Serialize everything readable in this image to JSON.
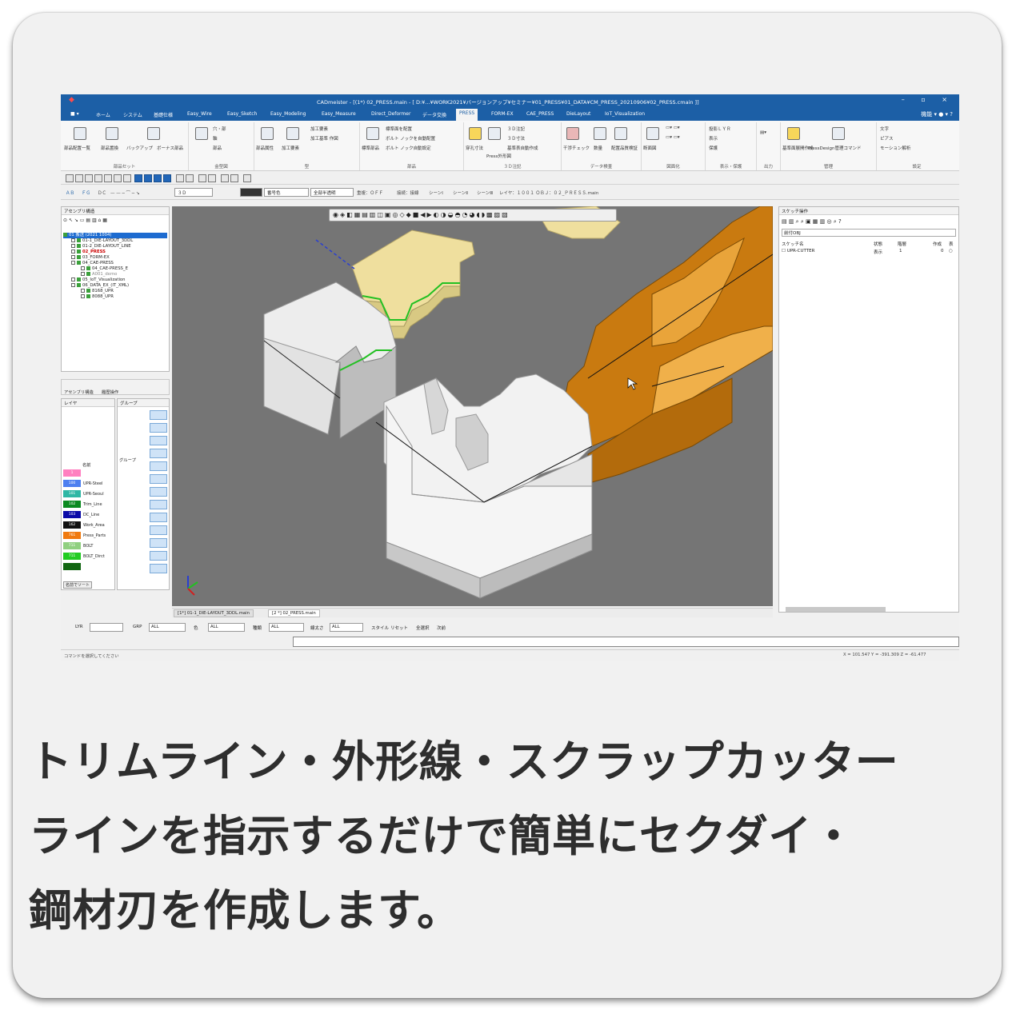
{
  "app": {
    "title": "CADmeister - [(1*) 02_PRESS.main - [ D:¥...¥WORK2021¥バージョンアップ¥セミナー¥01_PRESS¥01_DATA¥CM_PRESS_20210906¥02_PRESS.cmain ]]",
    "window_controls": "– ▫ ×"
  },
  "ribbon_tabs": [
    "ホーム",
    "システム",
    "基礎仕様",
    "Easy_Wire",
    "Easy_Sketch",
    "Easy_Modeling",
    "Easy_Measure",
    "Direct_Deformer",
    "データ交換",
    "PRESS",
    "FORM-EX",
    "CAE_PRESS",
    "DieLayout",
    "IoT_Visualization"
  ],
  "active_tab": "PRESS",
  "tabs_right": "機能 ▾ ● ▾ ?",
  "ribbon_groups": [
    {
      "label": "部品セット",
      "items": [
        "部品配置一覧",
        "部品置換",
        "バックアップ",
        "ボーナス部品"
      ]
    },
    {
      "label": "金型図",
      "items": [
        "穴・部",
        "軸",
        "部品"
      ]
    },
    {
      "label": "型",
      "items": [
        "部品属性",
        "加工要素",
        "加工要素",
        "加工基準 作図"
      ]
    },
    {
      "label": "部品",
      "items": [
        "標準部品",
        "標準面を配置",
        "ボルト ノックを自動配置",
        "ボルト ノック自動設定"
      ]
    },
    {
      "label": "３Ｄ注記",
      "items": [
        "穿孔寸法",
        "Press外形図",
        "３Ｄ注記",
        "３Ｄ寸法",
        "基準表自動作成"
      ]
    },
    {
      "label": "データ検査",
      "items": [
        "干渉チェック",
        "数量",
        "配置品質検証"
      ]
    },
    {
      "label": "図面化",
      "items": [
        "断面図",
        "図面化"
      ]
    },
    {
      "label": "表示・保護",
      "items": [
        "投影ＬＹＲ",
        "表示",
        "保護"
      ]
    },
    {
      "label": "出力",
      "items": [
        "出力"
      ]
    },
    {
      "label": "管理",
      "items": [
        "基準面展開作成",
        "PressDesign管理コマンド"
      ]
    },
    {
      "label": "設定",
      "items": [
        "文字",
        "ピアス",
        "モーション解析"
      ]
    }
  ],
  "options_bar": {
    "mode_buttons": [
      "ＡＢ",
      "ＦＧ",
      "ＤＣ"
    ],
    "view_select": "３Ｄ",
    "layer_select": "番号色",
    "color_select": "全部半透明",
    "status_items": [
      "重複：ＯＦＦ",
      "接続：接線",
      "シーンⅠ",
      "シーンⅡ",
      "シーンⅢ",
      "レイヤ：１００１ ＯＢＪ：０２_ＰＲＥＳＳ.main"
    ]
  },
  "assembly_panel": {
    "title": "アセンブリ構造",
    "tree": [
      {
        "label": "01 搬送 (2021 1004) ",
        "level": 0,
        "selected": true
      },
      {
        "label": "01-1_DIE-LAYOUT_3DDL",
        "level": 1
      },
      {
        "label": "01-2_DIE-LAYOUT_LINE",
        "level": 1
      },
      {
        "label": "02_PRESS",
        "level": 1,
        "highlight": true
      },
      {
        "label": "03_FORM-EX",
        "level": 1
      },
      {
        "label": "04_CAE-PRESS",
        "level": 1
      },
      {
        "label": "04_CAE-PRESS_E",
        "level": 2
      },
      {
        "label": "A001_demo",
        "level": 2
      },
      {
        "label": "05_IoT_Visualization",
        "level": 1
      },
      {
        "label": "06_DATA_EX_(IT_XML)",
        "level": 1
      },
      {
        "label": "8168_UPR",
        "level": 2
      },
      {
        "label": "8088_UPR",
        "level": 2
      }
    ],
    "bottom_tabs": [
      "アセンブリ構造",
      "履歴操作"
    ]
  },
  "layer_panel": {
    "title": "レイヤ",
    "header": "名前",
    "rows": [
      {
        "num": "1",
        "name": "",
        "color": "#ff80c0"
      },
      {
        "num": "100",
        "name": "UPR-Steel",
        "color": "#4d7ff0"
      },
      {
        "num": "101",
        "name": "UPR-Seoul",
        "color": "#2fb7a5"
      },
      {
        "num": "102",
        "name": "Trim_Line",
        "color": "#0b8a20"
      },
      {
        "num": "103",
        "name": "DC_Line",
        "color": "#0a0aa8"
      },
      {
        "num": "162",
        "name": "Work_Area",
        "color": "#111111"
      },
      {
        "num": "761",
        "name": "Press_Parts",
        "color": "#f07a10"
      },
      {
        "num": "711",
        "name": "BOLT",
        "color": "#90d080"
      },
      {
        "num": "711",
        "name": "BOLT_Dirct",
        "color": "#22cc22"
      },
      {
        "num": "",
        "name": "",
        "color": "#126612"
      }
    ],
    "footer": "名前でソート"
  },
  "group_panel": {
    "title": "グループ",
    "rows": [
      "グループ"
    ]
  },
  "right_panel": {
    "title": "スケッチ操作",
    "filter": "前付OBJ",
    "columns": [
      "スケッチ名",
      "状態",
      "階層",
      "作成",
      "表"
    ],
    "rows": [
      {
        "name": "UPR-CUTTER",
        "state": "表示",
        "level": "1",
        "c4": "0",
        "c5": "○"
      }
    ]
  },
  "doc_tabs": [
    {
      "label": "[1*] 01-1_DIE-LAYOUT_3DDL.main",
      "active": false
    },
    {
      "label": "[2 *] 02_PRESS.main",
      "active": true
    }
  ],
  "filter_bar": {
    "labels": [
      "LYR",
      "GRP",
      "色",
      "種類",
      "線太さ"
    ],
    "values": [
      "",
      "ALL",
      "ALL",
      "ALL",
      "ALL"
    ],
    "buttons": [
      "スタイル",
      "リセット",
      "全選択",
      "次前"
    ]
  },
  "status": {
    "left": "コマンドを選択してください",
    "coords": "X = 101.547  Y = -391.309  Z = -61.477"
  },
  "caption": {
    "line1": "トリムライン・外形線・スクラップカッター",
    "line2": "ラインを指示するだけで簡単にセクダイ・",
    "line3": "鋼材刃を作成します。"
  },
  "colors": {
    "titlebar": "#1c5fa6",
    "viewport_bg": "#757575",
    "part_yellow": "#f0e0a0",
    "part_orange": "#c97a10",
    "part_white": "#f2f2f2",
    "trim_green": "#22c022",
    "axis_blue": "#2a3fd0"
  }
}
